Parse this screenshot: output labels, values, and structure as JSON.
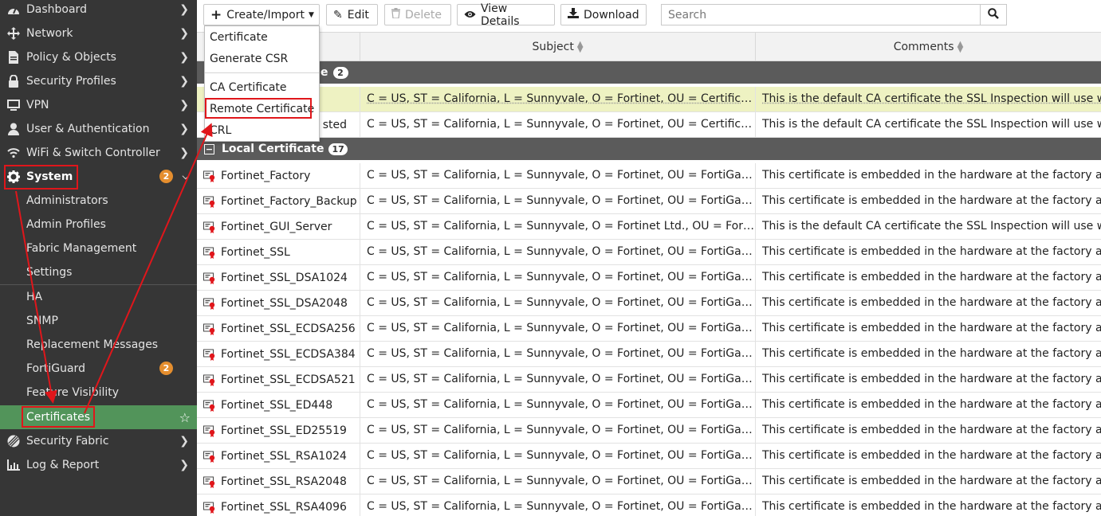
{
  "sidebar": {
    "items": [
      {
        "label": "Dashboard",
        "icon": "dashboard-icon"
      },
      {
        "label": "Network",
        "icon": "network-icon"
      },
      {
        "label": "Policy & Objects",
        "icon": "policy-icon"
      },
      {
        "label": "Security Profiles",
        "icon": "lock-icon"
      },
      {
        "label": "VPN",
        "icon": "monitor-icon"
      },
      {
        "label": "User & Authentication",
        "icon": "user-icon"
      },
      {
        "label": "WiFi & Switch Controller",
        "icon": "wifi-icon"
      },
      {
        "label": "System",
        "icon": "gear-icon",
        "badge": "2"
      }
    ],
    "system_sub": [
      "Administrators",
      "Admin Profiles",
      "Fabric Management",
      "Settings",
      "HA",
      "SNMP",
      "Replacement Messages",
      "FortiGuard",
      "Feature Visibility",
      "Certificates"
    ],
    "fortiguard_badge": "2",
    "bottom_items": [
      {
        "label": "Security Fabric",
        "icon": "fabric-icon"
      },
      {
        "label": "Log & Report",
        "icon": "chart-icon"
      }
    ]
  },
  "toolbar": {
    "create_label": "Create/Import",
    "edit_label": "Edit",
    "delete_label": "Delete",
    "view_label": "View Details",
    "download_label": "Download",
    "search_placeholder": "Search"
  },
  "dropdown": {
    "items": [
      "Certificate",
      "Generate CSR",
      "CA Certificate",
      "Remote Certificate",
      "CRL"
    ]
  },
  "table": {
    "headers": {
      "subject": "Subject",
      "comments": "Comments"
    },
    "group1": {
      "label_tail": "e",
      "count": "2"
    },
    "group1_rows": [
      {
        "name": "",
        "subject": "C = US, ST = California, L = Sunnyvale, O = Fortinet, OU = Certificate Aut…",
        "comment": "This is the default CA certificate the SSL Inspection will use when g"
      },
      {
        "name": "sted",
        "subject": "C = US, ST = California, L = Sunnyvale, O = Fortinet, OU = Certificate Aut…",
        "comment": "This is the default CA certificate the SSL Inspection will use when g"
      }
    ],
    "group2": {
      "label": "Local Certificate",
      "count": "17"
    },
    "local_rows": [
      {
        "name": "Fortinet_Factory",
        "subject": "C = US, ST = California, L = Sunnyvale, O = Fortinet, OU = FortiGate, CN …",
        "comment": "This certificate is embedded in the hardware at the factory and is u"
      },
      {
        "name": "Fortinet_Factory_Backup",
        "subject": "C = US, ST = California, L = Sunnyvale, O = Fortinet, OU = FortiGate, CN …",
        "comment": "This certificate is embedded in the hardware at the factory and is u"
      },
      {
        "name": "Fortinet_GUI_Server",
        "subject": "C = US, ST = California, L = Sunnyvale, O = Fortinet Ltd., OU = FortiGate, …",
        "comment": "This is the default CA certificate the SSL Inspection will use when g"
      },
      {
        "name": "Fortinet_SSL",
        "subject": "C = US, ST = California, L = Sunnyvale, O = Fortinet, OU = FortiGate, CN …",
        "comment": "This certificate is embedded in the hardware at the factory and is u"
      },
      {
        "name": "Fortinet_SSL_DSA1024",
        "subject": "C = US, ST = California, L = Sunnyvale, O = Fortinet, OU = FortiGate, CN …",
        "comment": "This certificate is embedded in the hardware at the factory and is u"
      },
      {
        "name": "Fortinet_SSL_DSA2048",
        "subject": "C = US, ST = California, L = Sunnyvale, O = Fortinet, OU = FortiGate, CN …",
        "comment": "This certificate is embedded in the hardware at the factory and is u"
      },
      {
        "name": "Fortinet_SSL_ECDSA256",
        "subject": "C = US, ST = California, L = Sunnyvale, O = Fortinet, OU = FortiGate, CN …",
        "comment": "This certificate is embedded in the hardware at the factory and is u"
      },
      {
        "name": "Fortinet_SSL_ECDSA384",
        "subject": "C = US, ST = California, L = Sunnyvale, O = Fortinet, OU = FortiGate, CN …",
        "comment": "This certificate is embedded in the hardware at the factory and is u"
      },
      {
        "name": "Fortinet_SSL_ECDSA521",
        "subject": "C = US, ST = California, L = Sunnyvale, O = Fortinet, OU = FortiGate, CN …",
        "comment": "This certificate is embedded in the hardware at the factory and is u"
      },
      {
        "name": "Fortinet_SSL_ED448",
        "subject": "C = US, ST = California, L = Sunnyvale, O = Fortinet, OU = FortiGate, CN …",
        "comment": "This certificate is embedded in the hardware at the factory and is u"
      },
      {
        "name": "Fortinet_SSL_ED25519",
        "subject": "C = US, ST = California, L = Sunnyvale, O = Fortinet, OU = FortiGate, CN …",
        "comment": "This certificate is embedded in the hardware at the factory and is u"
      },
      {
        "name": "Fortinet_SSL_RSA1024",
        "subject": "C = US, ST = California, L = Sunnyvale, O = Fortinet, OU = FortiGate, CN …",
        "comment": "This certificate is embedded in the hardware at the factory and is u"
      },
      {
        "name": "Fortinet_SSL_RSA2048",
        "subject": "C = US, ST = California, L = Sunnyvale, O = Fortinet, OU = FortiGate, CN …",
        "comment": "This certificate is embedded in the hardware at the factory and is u"
      },
      {
        "name": "Fortinet_SSL_RSA4096",
        "subject": "C = US, ST = California, L = Sunnyvale, O = Fortinet, OU = FortiGate, CN …",
        "comment": "This certificate is embedded in the hardware at the factory and is u"
      }
    ]
  },
  "colors": {
    "sidebar_bg": "#363636",
    "active_green": "#52945a",
    "badge_orange": "#e58e2e",
    "group_bg": "#5b5b5b",
    "highlight_row": "#eef2c2",
    "annotation_red": "#e0161b"
  }
}
